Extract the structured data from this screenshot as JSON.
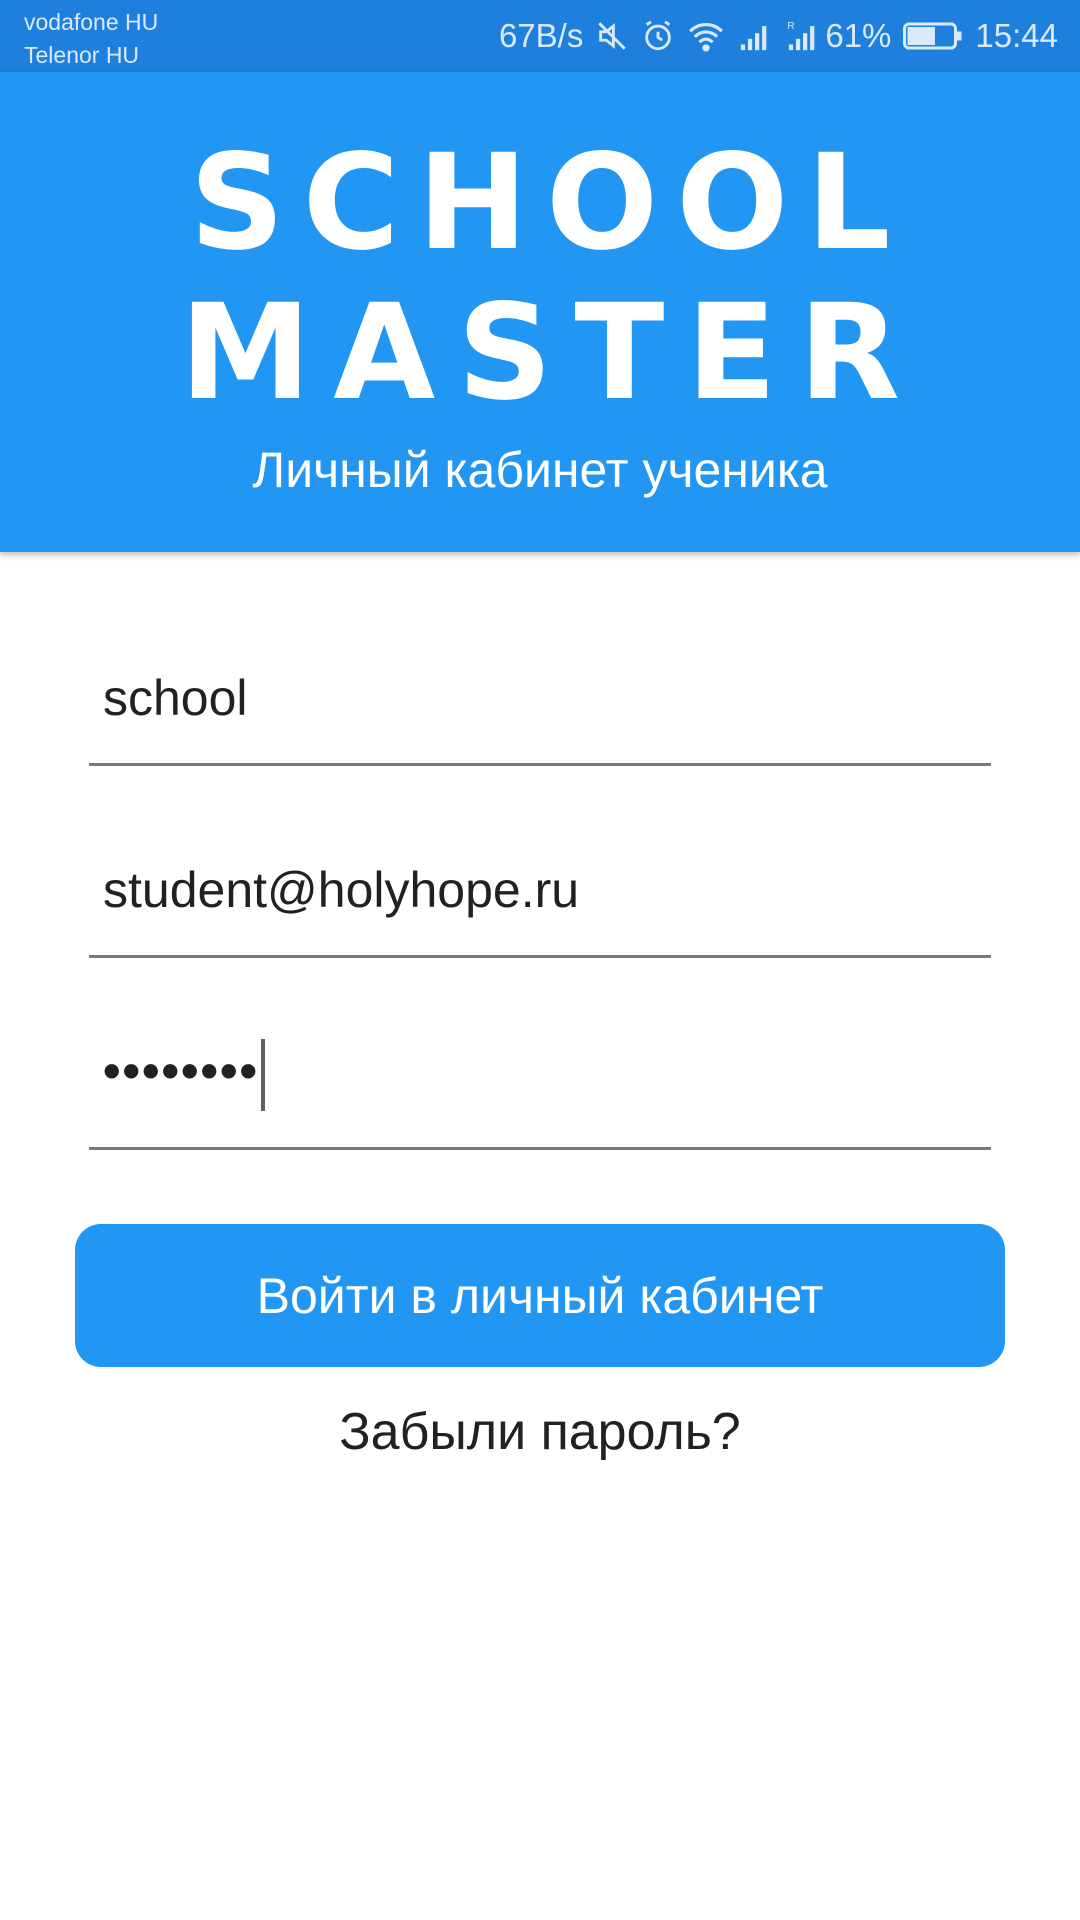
{
  "status_bar": {
    "carrier1": "vodafone HU",
    "carrier2": "Telenor HU",
    "net_speed": "67B/s",
    "battery_percent": "61%",
    "battery_level": 0.61,
    "time": "15:44",
    "icons": [
      "mute-icon",
      "alarm-icon",
      "wifi-icon",
      "signal-icon",
      "roaming-signal-icon",
      "battery-icon"
    ]
  },
  "header": {
    "logo_line1": "SCHOOL",
    "logo_line2": "MASTER",
    "subtitle": "Личный кабинет ученика",
    "background_color": "#2196f3"
  },
  "form": {
    "school_value": "school",
    "email_value": "student@holyhope.ru",
    "password_masked": "••••••••",
    "login_button_label": "Войти в личный кабинет",
    "forgot_password_label": "Забыли пароль?"
  },
  "colors": {
    "accent": "#2196f3",
    "status_bar": "#1f7fdc",
    "text": "#212121"
  }
}
